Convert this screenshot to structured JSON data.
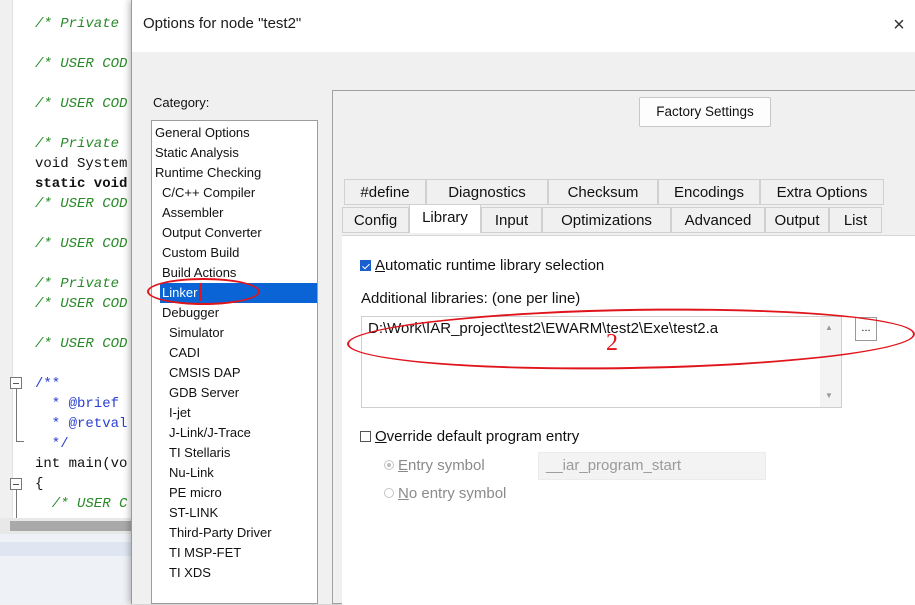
{
  "editor": {
    "lines": [
      {
        "text": "/* Private",
        "style": "c-comment"
      },
      {
        "text": "/* USER COD",
        "style": "c-comment"
      },
      {
        "text": "/* USER COD",
        "style": "c-comment"
      },
      {
        "text": "/* Private",
        "style": "c-comment"
      },
      {
        "text": "void System",
        "style": "c-plain"
      },
      {
        "text": "static void",
        "style": "c-kw"
      },
      {
        "text": "/* USER COD",
        "style": "c-comment"
      },
      {
        "text": "/* USER COD",
        "style": "c-comment"
      },
      {
        "text": "/* Private",
        "style": "c-comment"
      },
      {
        "text": "/* USER COD",
        "style": "c-comment"
      },
      {
        "text": "/* USER COD",
        "style": "c-comment"
      },
      {
        "text": "/**",
        "style": "c-doc"
      },
      {
        "text": "  * @brief",
        "style": "c-doc"
      },
      {
        "text": "  * @retval",
        "style": "c-doc"
      },
      {
        "text": "  */",
        "style": "c-doc"
      },
      {
        "text": "int main(vo",
        "style": "c-plain"
      },
      {
        "text": "{",
        "style": "c-plain"
      },
      {
        "text": "  /* USER C",
        "style": "c-comment"
      }
    ]
  },
  "dialog": {
    "title": "Options for node \"test2\"",
    "close_icon": "×",
    "category_label": "Category:",
    "factory_settings": "Factory Settings"
  },
  "categories": [
    {
      "label": "General Options",
      "level": 0
    },
    {
      "label": "Static Analysis",
      "level": 0
    },
    {
      "label": "Runtime Checking",
      "level": 0
    },
    {
      "label": "C/C++ Compiler",
      "level": 1
    },
    {
      "label": "Assembler",
      "level": 1
    },
    {
      "label": "Output Converter",
      "level": 1
    },
    {
      "label": "Custom Build",
      "level": 1
    },
    {
      "label": "Build Actions",
      "level": 1
    },
    {
      "label": "Linker",
      "level": 1,
      "selected": true
    },
    {
      "label": "Debugger",
      "level": 1
    },
    {
      "label": "Simulator",
      "level": 2
    },
    {
      "label": "CADI",
      "level": 2
    },
    {
      "label": "CMSIS DAP",
      "level": 2
    },
    {
      "label": "GDB Server",
      "level": 2
    },
    {
      "label": "I-jet",
      "level": 2
    },
    {
      "label": "J-Link/J-Trace",
      "level": 2
    },
    {
      "label": "TI Stellaris",
      "level": 2
    },
    {
      "label": "Nu-Link",
      "level": 2
    },
    {
      "label": "PE micro",
      "level": 2
    },
    {
      "label": "ST-LINK",
      "level": 2
    },
    {
      "label": "Third-Party Driver",
      "level": 2
    },
    {
      "label": "TI MSP-FET",
      "level": 2
    },
    {
      "label": "TI XDS",
      "level": 2
    }
  ],
  "tabs_row1": [
    "#define",
    "Diagnostics",
    "Checksum",
    "Encodings",
    "Extra Options"
  ],
  "tabs_row2": [
    "Config",
    "Library",
    "Input",
    "Optimizations",
    "Advanced",
    "Output",
    "List"
  ],
  "active_tab": "Library",
  "library": {
    "auto_label": "Automatic runtime library selection",
    "auto_checked": true,
    "additional_label": "Additional libraries: (one per line)",
    "additional_value": "D:\\Work\\IAR_project\\test2\\EWARM\\test2\\Exe\\test2.a",
    "browse_label": "...",
    "override_label": "Override default program entry",
    "override_checked": false,
    "entry_symbol_label": "Entry symbol",
    "entry_symbol_value": "__iar_program_start",
    "no_entry_label": "No entry symbol"
  },
  "annotations": {
    "number_2": "2"
  },
  "colors": {
    "selection": "#0a64d6",
    "annotation": "#e0141b"
  }
}
